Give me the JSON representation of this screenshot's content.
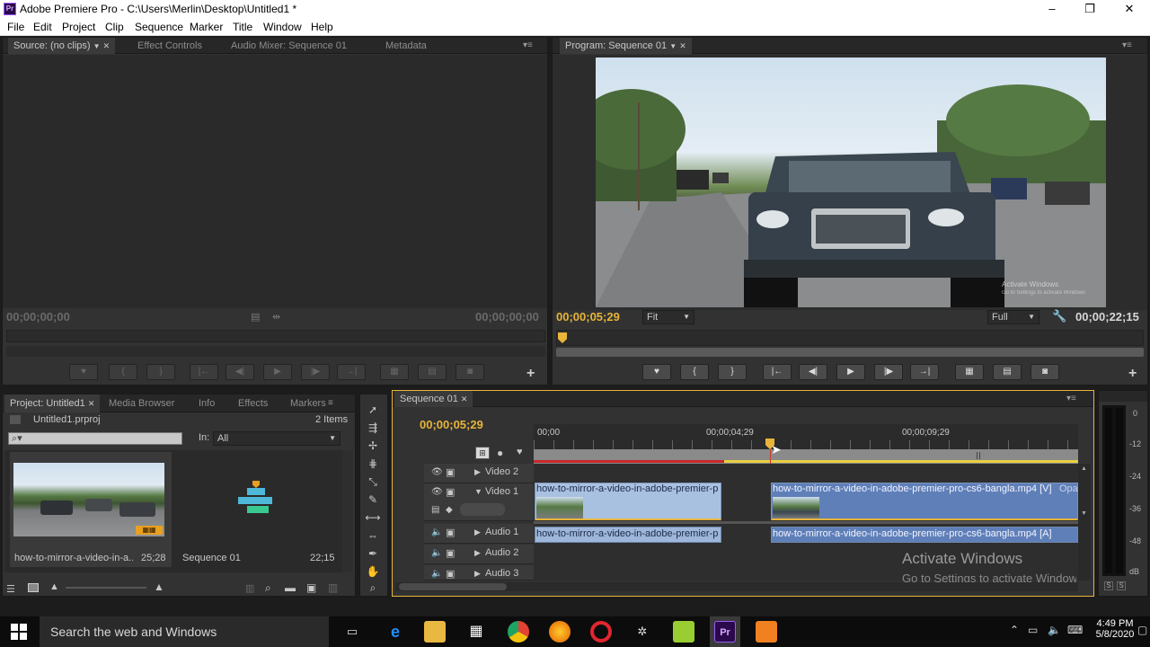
{
  "window": {
    "title": "Adobe Premiere Pro - C:\\Users\\Merlin\\Desktop\\Untitled1 *",
    "logo_text": "Pr",
    "controls": {
      "minimize": "–",
      "maximize": "❐",
      "close": "✕"
    }
  },
  "menu": [
    "File",
    "Edit",
    "Project",
    "Clip",
    "Sequence",
    "Marker",
    "Title",
    "Window",
    "Help"
  ],
  "source_panel": {
    "tabs": [
      "Source: (no clips)",
      "Effect Controls",
      "Audio Mixer: Sequence 01",
      "Metadata"
    ],
    "timecode_left": "00;00;00;00",
    "timecode_right": "00;00;00;00",
    "add_icon": "+"
  },
  "program_panel": {
    "tab": "Program: Sequence 01",
    "timecode_current": "00;00;05;29",
    "timecode_duration": "00;00;22;15",
    "zoom": "Fit",
    "quality": "Full",
    "watermark_line1": "Activate Windows",
    "watermark_line2": "Go to Settings to activate Windows",
    "add_icon": "+"
  },
  "project_panel": {
    "tabs": [
      "Project: Untitled1",
      "Media Browser",
      "Info",
      "Effects",
      "Markers"
    ],
    "filename": "Untitled1.prproj",
    "item_count": "2 Items",
    "in_label": "In:",
    "in_value": "All",
    "items": [
      {
        "name": "how-to-mirror-a-video-in-a...",
        "duration": "25;28"
      },
      {
        "name": "Sequence 01",
        "duration": "22;15"
      }
    ]
  },
  "timeline": {
    "tab": "Sequence 01",
    "timecode": "00;00;05;29",
    "ruler": [
      "00;00",
      "00;00;04;29",
      "00;00;09;29"
    ],
    "tracks": {
      "video2": "Video 2",
      "video1": "Video 1",
      "audio1": "Audio 1",
      "audio2": "Audio 2",
      "audio3": "Audio 3"
    },
    "clips": {
      "v1_a": "how-to-mirror-a-video-in-adobe-premier-p",
      "v1_b": "how-to-mirror-a-video-in-adobe-premier-pro-cs6-bangla.mp4 [V]",
      "v1_b_opacity": "Opac",
      "a1_a": "how-to-mirror-a-video-in-adobe-premier-p",
      "a1_b": "how-to-mirror-a-video-in-adobe-premier-pro-cs6-bangla.mp4 [A]"
    },
    "watermark_line1": "Activate Windows",
    "watermark_line2": "Go to Settings to activate Windows"
  },
  "audio_meter": {
    "labels": [
      "0",
      "-12",
      "-24",
      "-36",
      "-48",
      "dB"
    ],
    "solo_left": "S",
    "solo_right": "S"
  },
  "taskbar": {
    "search_placeholder": "Search the web and Windows",
    "time": "4:49 PM",
    "date": "5/8/2020",
    "apps": [
      "task-view",
      "edge",
      "file-explorer",
      "store",
      "chrome",
      "firefox",
      "opera",
      "tool",
      "folder",
      "premiere",
      "other"
    ],
    "premiere_label": "Pr"
  }
}
